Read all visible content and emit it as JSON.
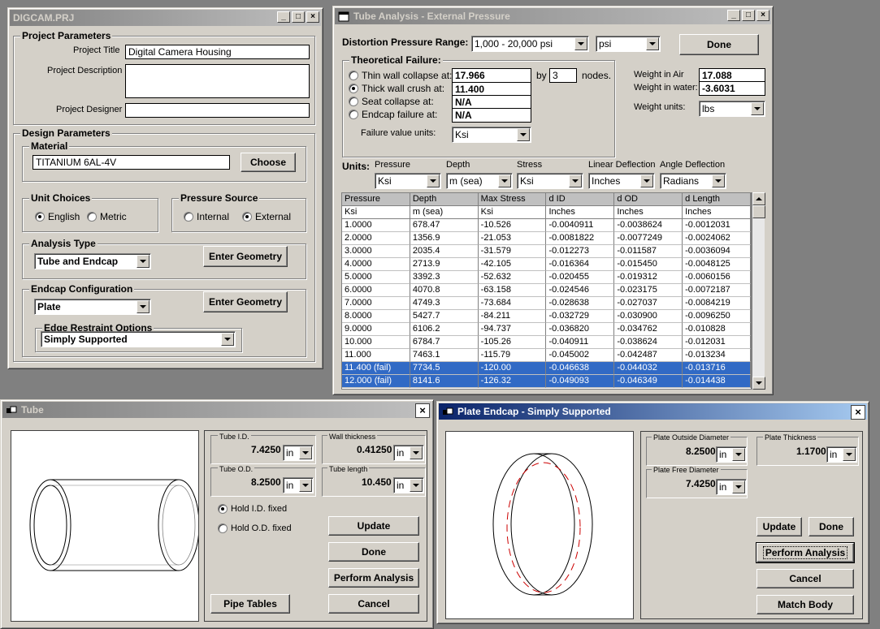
{
  "project_window": {
    "title": "DIGCAM.PRJ",
    "project_parameters": {
      "group_label": "Project Parameters",
      "title_label": "Project Title",
      "title_value": "Digital Camera Housing",
      "description_label": "Project Description",
      "description_value": "",
      "designer_label": "Project Designer",
      "designer_value": ""
    },
    "design_parameters": {
      "group_label": "Design Parameters",
      "material_label": "Material",
      "material_value": "TITANIUM 6AL-4V",
      "choose_button": "Choose",
      "unit_choices_label": "Unit Choices",
      "unit_english": "English",
      "unit_metric": "Metric",
      "pressure_source_label": "Pressure Source",
      "pressure_internal": "Internal",
      "pressure_external": "External",
      "analysis_type_label": "Analysis Type",
      "analysis_type_value": "Tube and Endcap",
      "enter_geometry_button": "Enter Geometry",
      "endcap_config_label": "Endcap Configuration",
      "endcap_config_value": "Plate",
      "enter_geometry_button_2": "Enter Geometry",
      "edge_restraint_label": "Edge Restraint Options",
      "edge_restraint_value": "Simply Supported"
    }
  },
  "analysis_window": {
    "title": "Tube Analysis - External Pressure",
    "distortion_label": "Distortion Pressure Range:",
    "distortion_range": "1,000 - 20,000 psi",
    "distortion_unit": "psi",
    "done_button": "Done",
    "theoretical_failure": {
      "group_label": "Theoretical Failure:",
      "thin_wall_label": "Thin wall collapse at:",
      "thin_wall_value": "17.966",
      "by_label": "by",
      "nodes_value": "3",
      "nodes_label": "nodes.",
      "thick_wall_label": "Thick wall crush at:",
      "thick_wall_value": "11.400",
      "seat_label": "Seat collapse at:",
      "seat_value": "N/A",
      "endcap_label": "Endcap failure at:",
      "endcap_value": "N/A",
      "failure_units_label": "Failure value units:",
      "failure_units_value": "Ksi"
    },
    "weight_air_label": "Weight in Air",
    "weight_air_value": "17.088",
    "weight_water_label": "Weight in water:",
    "weight_water_value": "-3.6031",
    "weight_units_label": "Weight units:",
    "weight_units_value": "lbs",
    "units_label": "Units:",
    "unit_selectors": [
      {
        "label": "Pressure",
        "value": "Ksi"
      },
      {
        "label": "Depth",
        "value": "m (sea)"
      },
      {
        "label": "Stress",
        "value": "Ksi"
      },
      {
        "label": "Linear Deflection",
        "value": "Inches"
      },
      {
        "label": "Angle Deflection",
        "value": "Radians"
      }
    ],
    "table": {
      "headers": [
        "Pressure",
        "Depth",
        "Max Stress",
        "d ID",
        "d OD",
        "d Length"
      ],
      "units": [
        "Ksi",
        "m (sea)",
        "Ksi",
        "Inches",
        "Inches",
        "Inches"
      ],
      "rows": [
        [
          "1.0000",
          "678.47",
          "-10.526",
          "-0.0040911",
          "-0.0038624",
          "-0.0012031"
        ],
        [
          "2.0000",
          "1356.9",
          "-21.053",
          "-0.0081822",
          "-0.0077249",
          "-0.0024062"
        ],
        [
          "3.0000",
          "2035.4",
          "-31.579",
          "-0.012273",
          "-0.011587",
          "-0.0036094"
        ],
        [
          "4.0000",
          "2713.9",
          "-42.105",
          "-0.016364",
          "-0.015450",
          "-0.0048125"
        ],
        [
          "5.0000",
          "3392.3",
          "-52.632",
          "-0.020455",
          "-0.019312",
          "-0.0060156"
        ],
        [
          "6.0000",
          "4070.8",
          "-63.158",
          "-0.024546",
          "-0.023175",
          "-0.0072187"
        ],
        [
          "7.0000",
          "4749.3",
          "-73.684",
          "-0.028638",
          "-0.027037",
          "-0.0084219"
        ],
        [
          "8.0000",
          "5427.7",
          "-84.211",
          "-0.032729",
          "-0.030900",
          "-0.0096250"
        ],
        [
          "9.0000",
          "6106.2",
          "-94.737",
          "-0.036820",
          "-0.034762",
          "-0.010828"
        ],
        [
          "10.000",
          "6784.7",
          "-105.26",
          "-0.040911",
          "-0.038624",
          "-0.012031"
        ],
        [
          "11.000",
          "7463.1",
          "-115.79",
          "-0.045002",
          "-0.042487",
          "-0.013234"
        ],
        [
          "11.400 (fail)",
          "7734.5",
          "-120.00",
          "-0.046638",
          "-0.044032",
          "-0.013716"
        ],
        [
          "12.000 (fail)",
          "8141.6",
          "-126.32",
          "-0.049093",
          "-0.046349",
          "-0.014438"
        ]
      ],
      "selected_rows": [
        11,
        12
      ]
    }
  },
  "tube_window": {
    "title": "Tube",
    "tube_id_label": "Tube I.D.",
    "tube_id_value": "7.4250",
    "tube_id_unit": "in",
    "wall_label": "Wall thickness",
    "wall_value": "0.41250",
    "wall_unit": "in",
    "tube_od_label": "Tube O.D.",
    "tube_od_value": "8.2500",
    "tube_od_unit": "in",
    "length_label": "Tube length",
    "length_value": "10.450",
    "length_unit": "in",
    "hold_id": "Hold I.D. fixed",
    "hold_od": "Hold O.D. fixed",
    "update_button": "Update",
    "done_button": "Done",
    "perform_button": "Perform Analysis",
    "pipe_tables_button": "Pipe Tables",
    "cancel_button": "Cancel"
  },
  "endcap_window": {
    "title": "Plate Endcap - Simply Supported",
    "outside_dia_label": "Plate Outside Diameter",
    "outside_dia_value": "8.2500",
    "outside_dia_unit": "in",
    "thickness_label": "Plate Thickness",
    "thickness_value": "1.1700",
    "thickness_unit": "in",
    "free_dia_label": "Plate Free Diameter",
    "free_dia_value": "7.4250",
    "free_dia_unit": "in",
    "update_button": "Update",
    "done_button": "Done",
    "perform_button": "Perform Analysis",
    "cancel_button": "Cancel",
    "match_button": "Match Body"
  }
}
